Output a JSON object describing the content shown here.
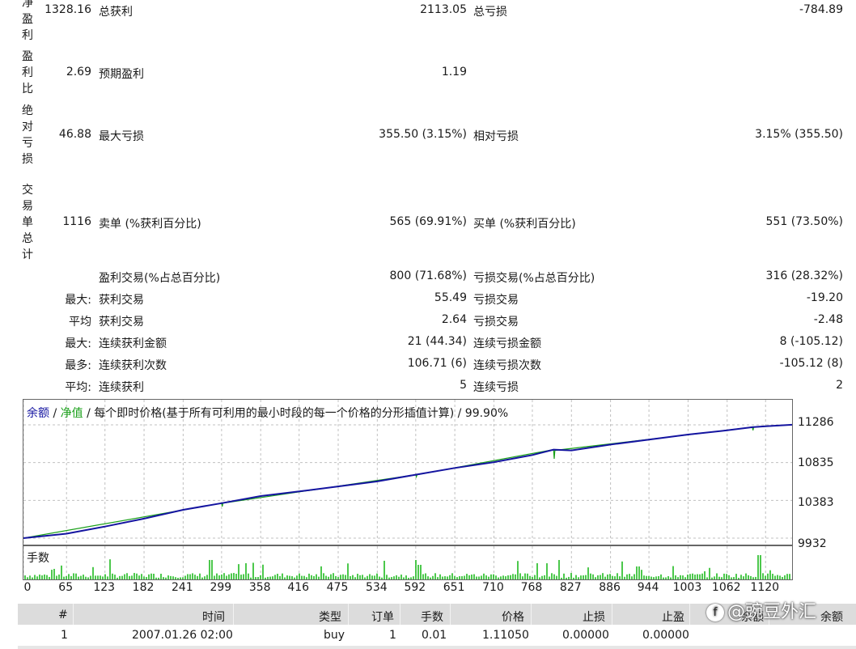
{
  "stats": {
    "row1": {
      "vlabel": "净盈利",
      "v0": "1328.16",
      "l1": "总获利",
      "v1": "2113.05",
      "l2": "总亏损",
      "v2": "-784.89"
    },
    "row2": {
      "vlabel": "盈利比",
      "v0": "2.69",
      "l1": "预期盈利",
      "v1": "1.19"
    },
    "row3": {
      "vlabel": "绝对亏损",
      "v0": "46.88",
      "l1": "最大亏损",
      "v1": "355.50 (3.15%)",
      "l2": "相对亏损",
      "v2": "3.15% (355.50)"
    },
    "row4": {
      "vlabel": "交易单总计",
      "v0": "1116",
      "l1": "卖单 (%获利百分比)",
      "v1": "565 (69.91%)",
      "l2": "买单 (%获利百分比)",
      "v2": "551 (73.50%)"
    },
    "row5": {
      "l1": "盈利交易(%占总百分比)",
      "v1": "800 (71.68%)",
      "l2": "亏损交易(%占总百分比)",
      "v2": "316 (28.32%)"
    },
    "row6": {
      "pre": "最大:",
      "l1": "获利交易",
      "v1": "55.49",
      "l2": "亏损交易",
      "v2": "-19.20"
    },
    "row7": {
      "pre": "平均",
      "l1": "获利交易",
      "v1": "2.64",
      "l2": "亏损交易",
      "v2": "-2.48"
    },
    "row8": {
      "pre": "最大:",
      "l1": "连续获利金额",
      "v1": "21 (44.34)",
      "l2": "连续亏损金额",
      "v2": "8 (-105.12)"
    },
    "row9": {
      "pre": "最多:",
      "l1": "连续获利次数",
      "v1": "106.71 (6)",
      "l2": "连续亏损次数",
      "v2": "-105.12 (8)"
    },
    "row10": {
      "pre": "平均:",
      "l1": "连续获利",
      "v1": "5",
      "l2": "连续亏损",
      "v2": "2"
    }
  },
  "chart_header": {
    "balance": "余额",
    "sep1": " / ",
    "equity": "净值",
    "rest": " / 每个即时价格(基于所有可利用的最小时段的每一个价格的分形插值计算) / 99.90%"
  },
  "lots_label": "手数",
  "chart_data": {
    "type": "line",
    "x_ticks": [
      "0",
      "65",
      "123",
      "182",
      "241",
      "299",
      "358",
      "416",
      "475",
      "534",
      "592",
      "651",
      "710",
      "768",
      "827",
      "886",
      "944",
      "1003",
      "1062",
      "1120"
    ],
    "y_ticks": [
      "11286",
      "10835",
      "10383",
      "9932"
    ],
    "xlim": [
      0,
      1160
    ],
    "ylim": [
      9932,
      11450
    ],
    "series": [
      {
        "name": "余额",
        "color": "#1414a0",
        "x": [
          0,
          65,
          123,
          182,
          241,
          299,
          358,
          416,
          475,
          534,
          592,
          651,
          710,
          768,
          800,
          827,
          886,
          944,
          1003,
          1062,
          1100,
          1120,
          1160
        ],
        "y": [
          9932,
          9985,
          10070,
          10165,
          10270,
          10350,
          10435,
          10490,
          10550,
          10610,
          10690,
          10770,
          10840,
          10925,
          10990,
          10980,
          11050,
          11110,
          11170,
          11220,
          11258,
          11268,
          11287
        ]
      },
      {
        "name": "净值",
        "color": "#1aa01a",
        "x": [
          0,
          299,
          300,
          301,
          592,
          593,
          594,
          800,
          801,
          802,
          1100,
          1101,
          1102,
          1160
        ],
        "y": [
          9932,
          10350,
          10310,
          10350,
          10690,
          10665,
          10690,
          10990,
          10880,
          10980,
          11258,
          11220,
          11258,
          11287
        ]
      }
    ],
    "lots": {
      "color": "#00b000"
    }
  },
  "table": {
    "headers": [
      "#",
      "时间",
      "类型",
      "订单",
      "手数",
      "价格",
      "止损",
      "止盈",
      "余额",
      "余额"
    ],
    "rows": [
      [
        "1",
        "2007.01.26 02:00",
        "buy",
        "1",
        "0.01",
        "1.11050",
        "0.00000",
        "0.00000"
      ]
    ]
  },
  "watermark": "@豌豆外汇",
  "colors": {
    "balance": "#1414a0",
    "equity": "#1aa01a",
    "lots": "#00b000",
    "grid": "#c0c0c0"
  }
}
